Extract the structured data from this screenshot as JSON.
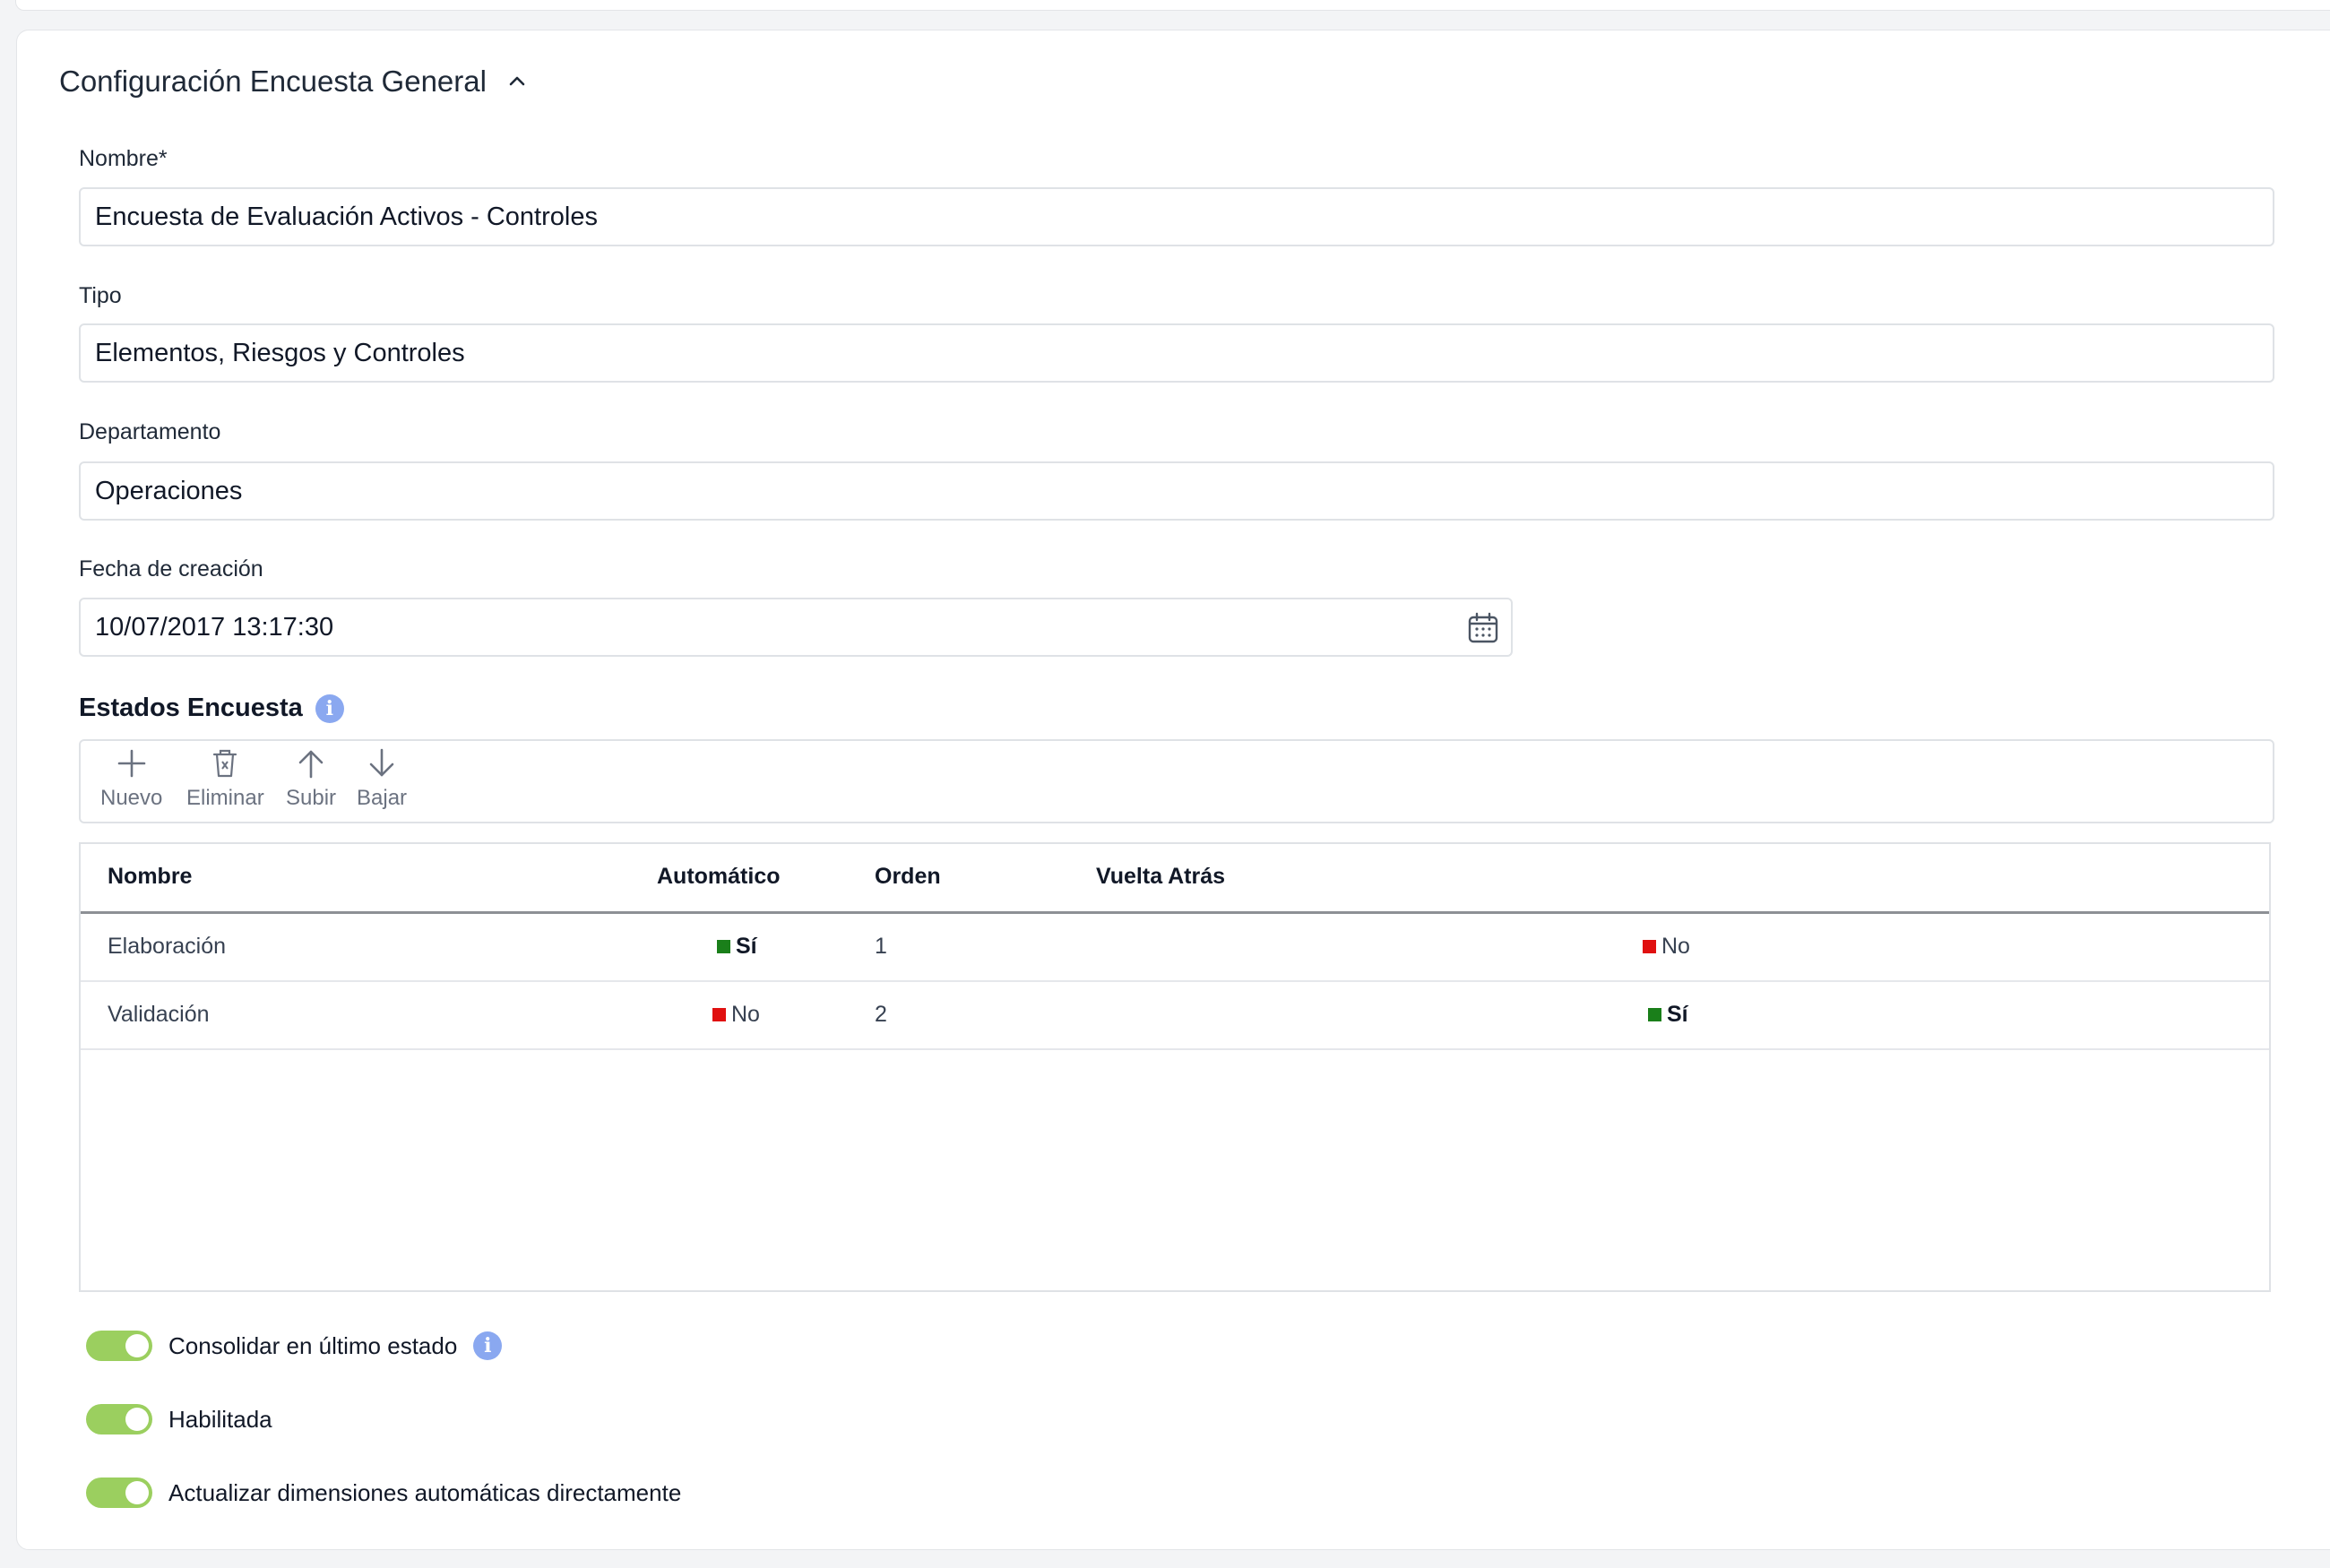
{
  "section": {
    "title": "Configuración Encuesta General"
  },
  "fields": {
    "nombre": {
      "label": "Nombre*",
      "value": "Encuesta de Evaluación Activos - Controles"
    },
    "tipo": {
      "label": "Tipo",
      "value": "Elementos, Riesgos y Controles"
    },
    "departamento": {
      "label": "Departamento",
      "value": "Operaciones"
    },
    "fecha": {
      "label": "Fecha de creación",
      "value": "10/07/2017 13:17:30"
    }
  },
  "estados": {
    "title": "Estados Encuesta",
    "info": "i",
    "toolbar": {
      "nuevo": "Nuevo",
      "eliminar": "Eliminar",
      "subir": "Subir",
      "bajar": "Bajar"
    },
    "columns": {
      "nombre": "Nombre",
      "automatico": "Automático",
      "orden": "Orden",
      "vuelta": "Vuelta Atrás"
    },
    "rows": [
      {
        "nombre": "Elaboración",
        "automatico": "Sí",
        "automatico_color": "#1a7f1a",
        "orden": "1",
        "vuelta": "No",
        "vuelta_color": "#e01010"
      },
      {
        "nombre": "Validación",
        "automatico": "No",
        "automatico_color": "#e01010",
        "orden": "2",
        "vuelta": "Sí",
        "vuelta_color": "#1a7f1a"
      }
    ]
  },
  "toggles": {
    "consolidar": {
      "label": "Consolidar en último estado",
      "on": true
    },
    "habilitada": {
      "label": "Habilitada",
      "on": true
    },
    "actualizar": {
      "label": "Actualizar dimensiones automáticas directamente",
      "on": true
    }
  },
  "colors": {
    "toggle_on": "#9bcf5f",
    "info": "#8aa8f0",
    "yes": "#1a7f1a",
    "no": "#e01010"
  }
}
